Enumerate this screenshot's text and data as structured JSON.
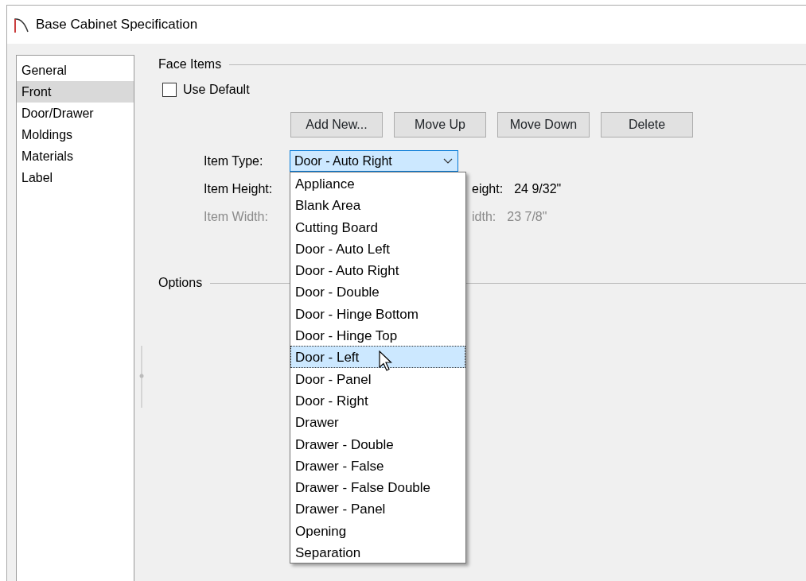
{
  "window": {
    "title": "Base Cabinet Specification"
  },
  "sidebar": {
    "items": [
      {
        "label": "General",
        "selected": false
      },
      {
        "label": "Front",
        "selected": true
      },
      {
        "label": "Door/Drawer",
        "selected": false
      },
      {
        "label": "Moldings",
        "selected": false
      },
      {
        "label": "Materials",
        "selected": false
      },
      {
        "label": "Label",
        "selected": false
      }
    ]
  },
  "face_items": {
    "legend": "Face Items",
    "use_default": {
      "label": "Use Default",
      "checked": false
    },
    "buttons": [
      "Add New...",
      "Move Up",
      "Move Down",
      "Delete"
    ],
    "item_type": {
      "label": "Item Type:",
      "value": "Door - Auto Right"
    },
    "rows": [
      {
        "label": "Item Height:",
        "readout_label": "eight:",
        "readout_value": "24 9/32\"",
        "disabled": false
      },
      {
        "label": "Item Width:",
        "readout_label": "idth:",
        "readout_value": "23 7/8\"",
        "disabled": true
      }
    ]
  },
  "dropdown": {
    "options": [
      {
        "label": "Appliance",
        "selected": false
      },
      {
        "label": "Blank Area",
        "selected": false
      },
      {
        "label": "Cutting Board",
        "selected": false
      },
      {
        "label": "Door - Auto Left",
        "selected": false
      },
      {
        "label": "Door - Auto Right",
        "selected": false
      },
      {
        "label": "Door - Double",
        "selected": false
      },
      {
        "label": "Door - Hinge Bottom",
        "selected": false
      },
      {
        "label": "Door - Hinge Top",
        "selected": false
      },
      {
        "label": "Door - Left",
        "selected": true
      },
      {
        "label": "Door - Panel",
        "selected": false
      },
      {
        "label": "Door - Right",
        "selected": false
      },
      {
        "label": "Drawer",
        "selected": false
      },
      {
        "label": "Drawer - Double",
        "selected": false
      },
      {
        "label": "Drawer - False",
        "selected": false
      },
      {
        "label": "Drawer - False Double",
        "selected": false
      },
      {
        "label": "Drawer - Panel",
        "selected": false
      },
      {
        "label": "Opening",
        "selected": false
      },
      {
        "label": "Separation",
        "selected": false
      }
    ]
  },
  "options": {
    "legend": "Options"
  }
}
